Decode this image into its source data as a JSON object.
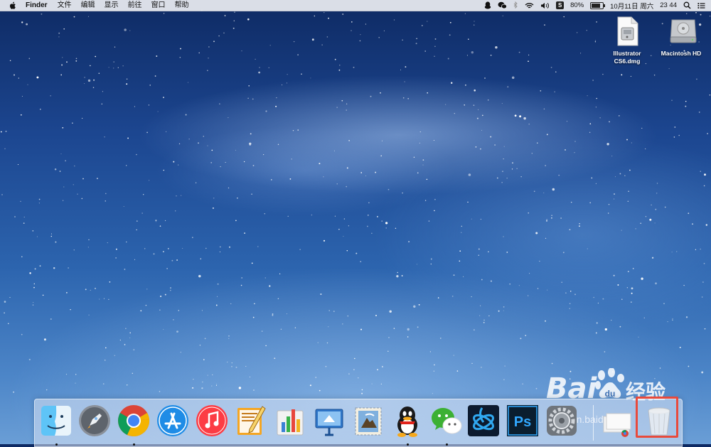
{
  "menubar": {
    "apple_icon": "apple-logo",
    "app_name": "Finder",
    "menus": [
      "文件",
      "编辑",
      "显示",
      "前往",
      "窗口",
      "帮助"
    ],
    "status": {
      "battery_percent": "80%",
      "battery_level": 0.8,
      "date": "10月11日 周六",
      "time": "23 44",
      "icons": [
        "qq-icon",
        "wechat-icon",
        "bluetooth-icon",
        "wifi-icon",
        "volume-icon",
        "s-app-icon",
        "battery-icon",
        "spotlight-icon",
        "notification-center-icon"
      ]
    }
  },
  "desktop": {
    "icons": [
      {
        "label_line1": "Illustrator",
        "label_line2": "CS6.dmg",
        "icon": "dmg-file-icon"
      },
      {
        "label_line1": "Macintosh HD",
        "label_line2": "",
        "icon": "hard-drive-icon"
      }
    ]
  },
  "dock": {
    "apps": [
      {
        "name": "Finder",
        "icon": "finder-icon",
        "running": true
      },
      {
        "name": "Launchpad",
        "icon": "launchpad-icon",
        "running": false
      },
      {
        "name": "Google Chrome",
        "icon": "chrome-icon",
        "running": true
      },
      {
        "name": "App Store",
        "icon": "app-store-icon",
        "running": false
      },
      {
        "name": "iTunes",
        "icon": "itunes-icon",
        "running": false
      },
      {
        "name": "Pages",
        "icon": "pages-icon",
        "running": false
      },
      {
        "name": "Numbers",
        "icon": "numbers-icon",
        "running": false
      },
      {
        "name": "Keynote",
        "icon": "keynote-icon",
        "running": false
      },
      {
        "name": "Mail",
        "icon": "mail-icon",
        "running": false
      },
      {
        "name": "QQ",
        "icon": "qq-icon",
        "running": true
      },
      {
        "name": "WeChat",
        "icon": "wechat-icon",
        "running": true
      },
      {
        "name": "Battle.net",
        "icon": "battlenet-icon",
        "running": false
      },
      {
        "name": "Photoshop",
        "icon": "photoshop-icon",
        "running": false,
        "label": "Ps"
      },
      {
        "name": "System Preferences",
        "icon": "system-preferences-icon",
        "running": false
      },
      {
        "name": "Downloads",
        "icon": "downloads-stack-icon",
        "running": false
      },
      {
        "name": "Trash",
        "icon": "trash-icon",
        "running": false
      }
    ]
  },
  "watermark": {
    "brand": "Bai",
    "brand_cn": "经验",
    "url": "jingyan.baidu.com"
  }
}
